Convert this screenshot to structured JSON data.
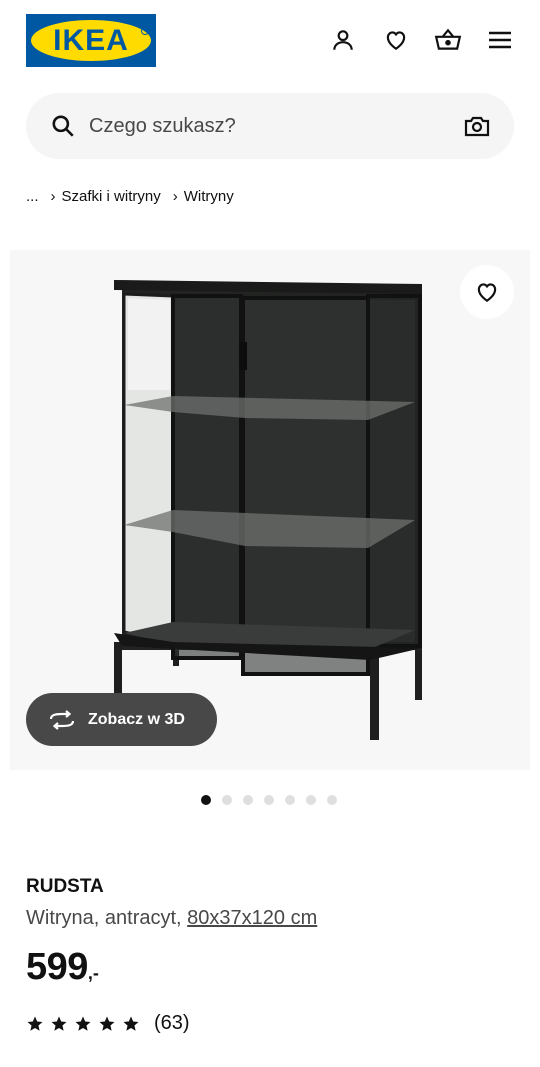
{
  "header": {
    "logo_text": "IKEA",
    "icons": [
      "account-icon",
      "heart-icon",
      "basket-icon",
      "menu-icon"
    ]
  },
  "search": {
    "placeholder": "Czego szukasz?",
    "icon": "search-icon",
    "visual_search_icon": "camera-icon"
  },
  "breadcrumb": {
    "ellipsis": "...",
    "items": [
      "Szafki i witryny",
      "Witryny"
    ]
  },
  "gallery": {
    "view_3d_label": "Zobacz w 3D",
    "dot_count": 7,
    "active_dot": 0
  },
  "product": {
    "name": "RUDSTA",
    "description": "Witryna, antracyt,",
    "size": "80x37x120 cm",
    "price_integer": "599",
    "price_suffix": ",-",
    "rating_stars": 5,
    "review_count": "(63)"
  },
  "colors": {
    "brand_blue": "#0058a3",
    "brand_yellow": "#ffdb00",
    "text": "#111111",
    "text_secondary": "#484848",
    "search_bg": "#f5f5f5"
  }
}
